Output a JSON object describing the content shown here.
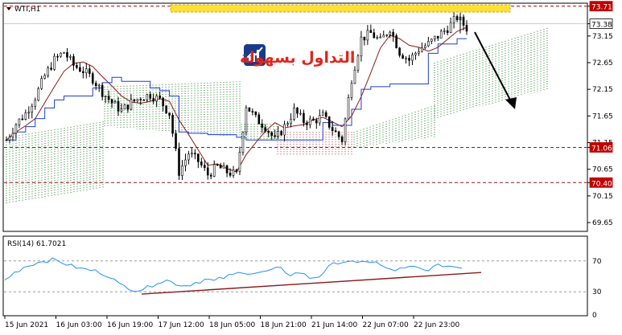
{
  "chart_data": {
    "type": "candlestick",
    "symbol_label": "WTI,H1",
    "price_axis": {
      "range": [
        69.5,
        73.75
      ],
      "ticks": [
        "73.71",
        "73.38",
        "73.15",
        "72.65",
        "72.15",
        "71.65",
        "71.15",
        "71.06",
        "70.65",
        "70.40",
        "70.15",
        "69.65"
      ],
      "highlight_labels": [
        {
          "value": "73.71",
          "bg": "#c00000"
        },
        {
          "value": "73.38",
          "bg": "#ffffff"
        },
        {
          "value": "71.06",
          "bg": "#c00000"
        },
        {
          "value": "70.40",
          "bg": "#c00000"
        }
      ]
    },
    "time_axis": {
      "labels": [
        "15 Jun 2021",
        "16 Jun 03:00",
        "16 Jun 19:00",
        "17 Jun 12:00",
        "18 Jun 05:00",
        "18 Jun 21:00",
        "21 Jun 14:00",
        "22 Jun 07:00",
        "22 Jun 23:00"
      ]
    },
    "horizontal_levels": [
      {
        "value": 73.71,
        "color": "#c00000",
        "style": "dashed"
      },
      {
        "value": 71.06,
        "color": "#8b1a1a",
        "style": "dashed"
      },
      {
        "value": 70.4,
        "color": "#8b1a1a",
        "style": "dashed"
      }
    ],
    "price_close_path": [
      71.2,
      71.5,
      71.7,
      72.0,
      72.4,
      72.7,
      72.85,
      72.6,
      72.5,
      72.35,
      72.1,
      71.9,
      71.75,
      71.9,
      72.0,
      72.05,
      71.95,
      71.7,
      70.6,
      70.95,
      70.8,
      70.55,
      70.7,
      70.6,
      70.55,
      71.85,
      71.6,
      71.45,
      71.2,
      71.45,
      71.75,
      71.55,
      71.55,
      71.65,
      71.4,
      71.2,
      72.35,
      73.1,
      73.2,
      73.05,
      73.3,
      72.85,
      72.7,
      72.9,
      73.0,
      73.15,
      73.3,
      73.5,
      73.3
    ],
    "rsi": {
      "label": "RSI(14) 61.7021",
      "range": [
        0,
        100
      ],
      "ticks": [
        "70",
        "30",
        "0"
      ],
      "levels": [
        70,
        30
      ],
      "values": [
        45,
        55,
        62,
        66,
        70,
        72,
        68,
        64,
        60,
        58,
        55,
        50,
        40,
        35,
        32,
        36,
        42,
        45,
        40,
        38,
        42,
        46,
        44,
        48,
        52,
        56,
        54,
        55,
        58,
        60,
        52,
        55,
        48,
        50,
        62,
        68,
        70,
        66,
        70,
        68,
        60,
        58,
        60,
        62,
        58,
        62,
        64,
        63,
        62
      ]
    },
    "annotations": [
      {
        "type": "trendline",
        "desc": "rising support under RSI"
      },
      {
        "type": "arrow",
        "desc": "downward arrow"
      },
      {
        "type": "rectangle",
        "desc": "yellow highlighted zone near top"
      }
    ]
  },
  "logo": {
    "text": "التداول بسهولة",
    "color": "#e0251b",
    "icon_color": "#1a3a8a"
  }
}
